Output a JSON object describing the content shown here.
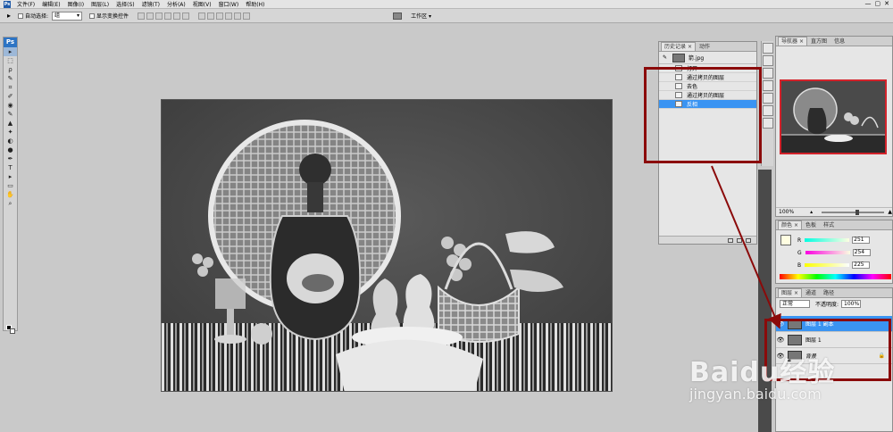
{
  "menubar": {
    "items": [
      "文件(F)",
      "编辑(E)",
      "图像(I)",
      "图层(L)",
      "选择(S)",
      "滤镜(T)",
      "分析(A)",
      "视图(V)",
      "窗口(W)",
      "帮助(H)"
    ],
    "window_controls": [
      "—",
      "▢",
      "✕"
    ]
  },
  "options": {
    "auto_select_label": "自动选择:",
    "auto_select_value": "组",
    "show_transform_label": "显示变换控件",
    "workspace_label": "工作区 ▾"
  },
  "toolbox": {
    "logo": "Ps",
    "tools": [
      "▸",
      "⬚",
      "ρ",
      "✎",
      "⌗",
      "✐",
      "◉",
      "✎",
      "▲",
      "✦",
      "◐",
      "●",
      "✒",
      "T",
      "▸",
      "▭",
      "✋",
      "⌕"
    ]
  },
  "history_panel": {
    "tabs": [
      "历史记录",
      "动作"
    ],
    "tab_close": "×",
    "source_label": "箭.jpg",
    "steps": [
      "打开",
      "通过拷贝的图层",
      "去色",
      "通过拷贝的图层",
      "反相"
    ],
    "selected_index": 4
  },
  "navigator_panel": {
    "tabs": [
      "导航器",
      "直方图",
      "信息"
    ],
    "zoom": "100%"
  },
  "color_panel": {
    "tabs": [
      "颜色",
      "色板",
      "样式"
    ],
    "channels": [
      {
        "label": "R",
        "value": "251"
      },
      {
        "label": "G",
        "value": "254"
      },
      {
        "label": "B",
        "value": "225"
      }
    ],
    "swatch_color": "#fffee1"
  },
  "layers_panel": {
    "tabs": [
      "图层",
      "通道",
      "路径"
    ],
    "blend_mode": "正常",
    "opacity_label": "不透明度:",
    "opacity_value": "100%",
    "layers": [
      {
        "name": "图层 1 副本",
        "selected": true,
        "locked": false
      },
      {
        "name": "图层 1",
        "selected": false,
        "locked": false
      },
      {
        "name": "背景",
        "selected": false,
        "locked": true
      }
    ],
    "lock_icon": "🔒"
  },
  "annotation": {
    "color": "#8b0a0a"
  },
  "watermark": {
    "brand": "Baidu经验",
    "url": "jingyan.baidu.com"
  }
}
